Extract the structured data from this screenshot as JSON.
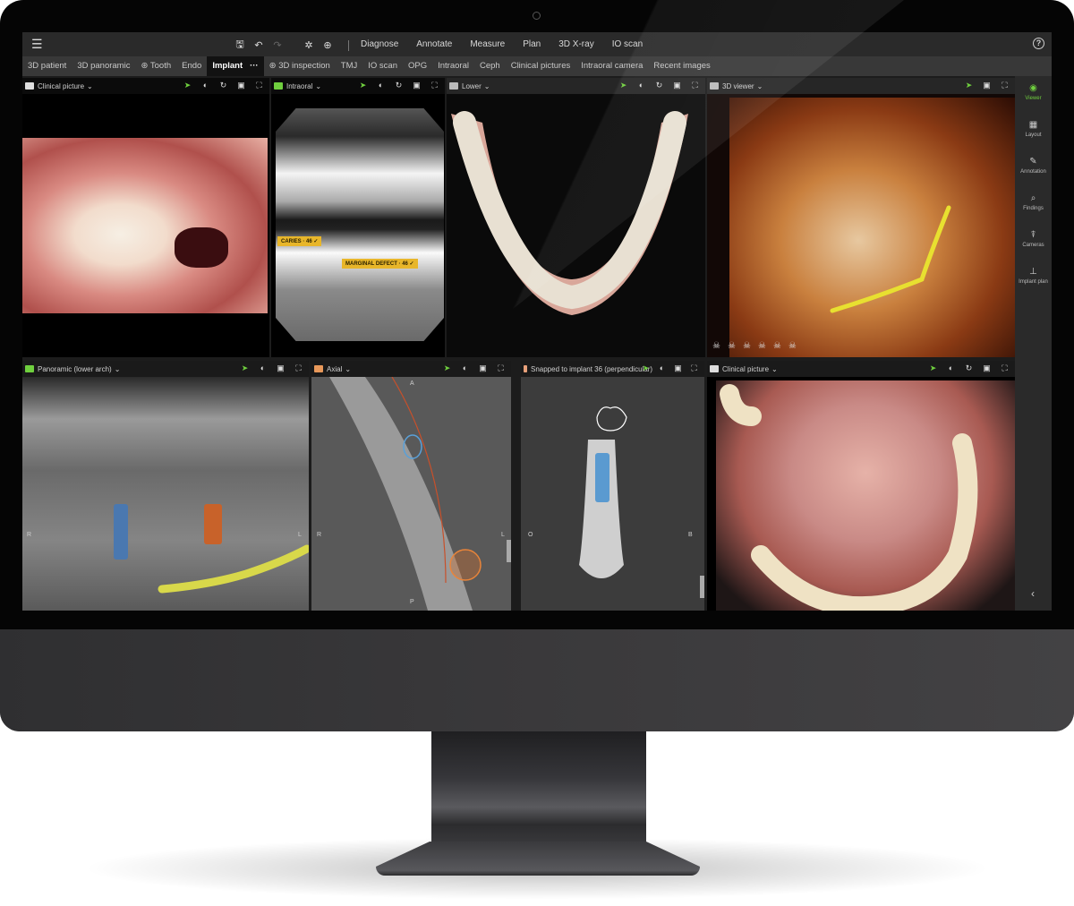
{
  "topbar": {
    "menu_icon": "hamburger-icon",
    "tools": [
      {
        "name": "save-icon",
        "glyph": "🖫"
      },
      {
        "name": "undo-icon",
        "glyph": "↶"
      },
      {
        "name": "redo-icon",
        "glyph": "↷"
      },
      {
        "name": "aperture-icon",
        "glyph": "✲"
      },
      {
        "name": "target-icon",
        "glyph": "⊕"
      }
    ],
    "main_nav": [
      "Diagnose",
      "Annotate",
      "Measure",
      "Plan",
      "3D X-ray",
      "IO scan"
    ],
    "help_label": "?"
  },
  "subnav": {
    "tabs": [
      "3D patient",
      "3D panoramic",
      "Tooth",
      "Endo",
      "Implant",
      "3D inspection",
      "TMJ",
      "IO scan",
      "OPG",
      "Intraoral",
      "Ceph",
      "Clinical pictures",
      "Intraoral camera",
      "Recent images"
    ],
    "active": "Implant",
    "more_label": "···"
  },
  "viewports": {
    "clinical_top": {
      "title": "Clinical picture"
    },
    "intraoral": {
      "title": "Intraoral"
    },
    "lower": {
      "title": "Lower"
    },
    "viewer3d": {
      "title": "3D viewer"
    },
    "panoramic": {
      "title": "Panoramic (lower arch)",
      "left_label": "R",
      "right_label": "L"
    },
    "axial": {
      "title": "Axial",
      "top_label": "A",
      "bottom_label": "P",
      "left_label": "R",
      "right_label": "L"
    },
    "snapped": {
      "title": "Snapped to implant 36 (perpendicular)",
      "left_label": "O",
      "right_label": "B"
    },
    "clinical_bottom": {
      "title": "Clinical picture"
    }
  },
  "findings": [
    {
      "label": "CARIES · 46 ✓"
    },
    {
      "label": "MARGINAL DEFECT · 46 ✓"
    }
  ],
  "sidebar": {
    "items": [
      {
        "label": "Viewer",
        "icon": "eye-icon",
        "glyph": "◉",
        "active": true
      },
      {
        "label": "Layout",
        "icon": "layout-icon",
        "glyph": "▦"
      },
      {
        "label": "Annotation",
        "icon": "pencil-icon",
        "glyph": "✎"
      },
      {
        "label": "Findings",
        "icon": "findings-icon",
        "glyph": "⌕"
      },
      {
        "label": "Cameras",
        "icon": "camera-icon",
        "glyph": "⍒"
      },
      {
        "label": "Implant plan",
        "icon": "implant-icon",
        "glyph": "⊥"
      }
    ],
    "collapse_glyph": "‹"
  },
  "colors": {
    "accent_green": "#6fcf3e",
    "finding_yellow": "#e8b62a",
    "canal_yellow": "#d8d84a",
    "implant_blue": "#4a78b0",
    "implant_orange": "#c8622a"
  }
}
